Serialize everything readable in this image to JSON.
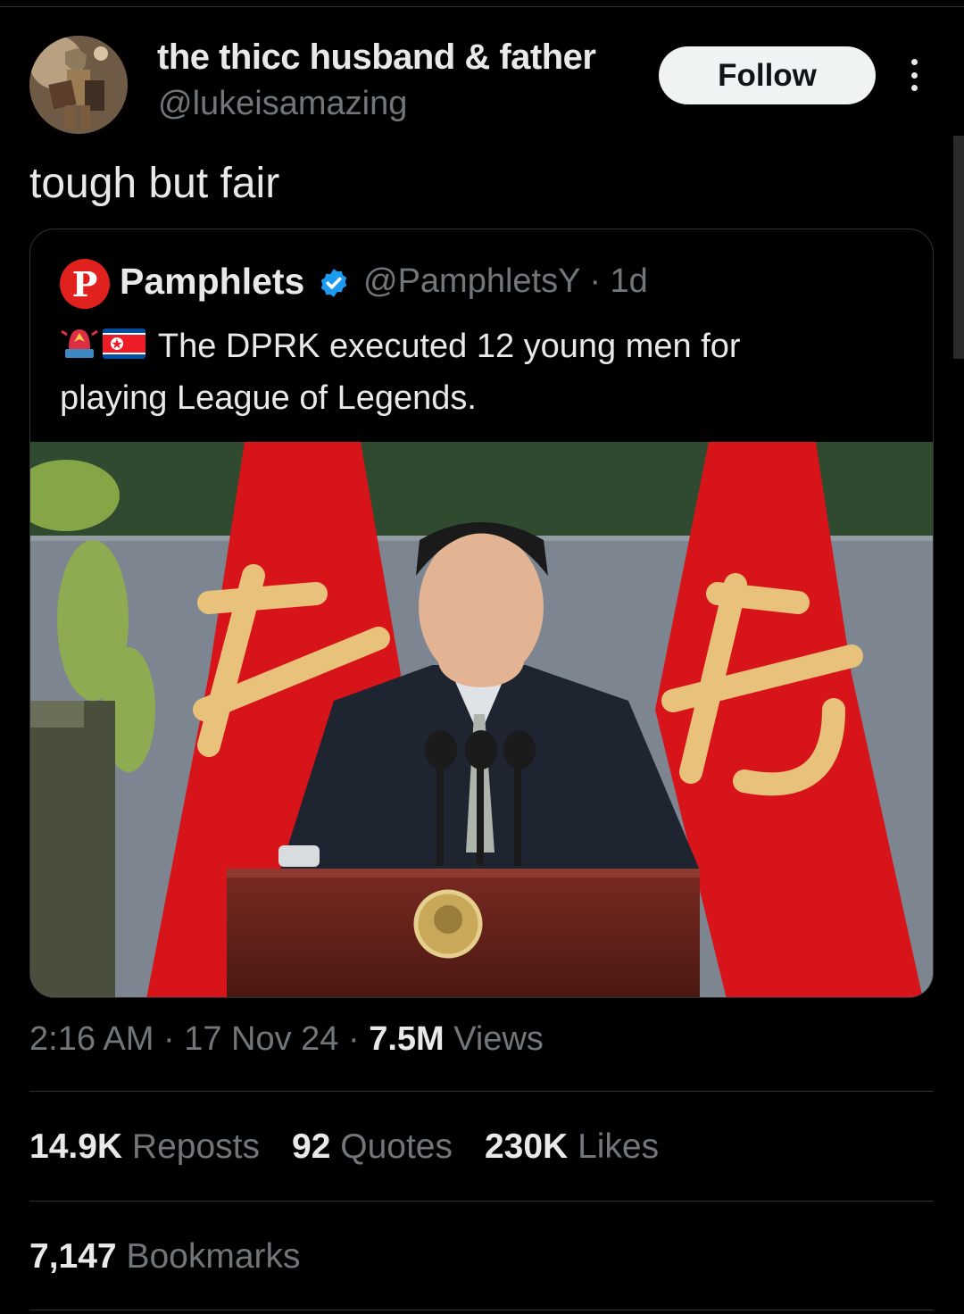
{
  "author": {
    "display_name": "the thicc husband & father",
    "handle": "@lukeisamazing"
  },
  "follow_label": "Follow",
  "tweet_text": "tough but fair",
  "quoted": {
    "logo_letter": "P",
    "name": "Pamphlets",
    "handle_time": "@PamphletsY · 1d",
    "emoji_icons": [
      "rotating-light-icon",
      "north-korea-flag-icon"
    ],
    "text_line1": "The DPRK executed 12 young men for",
    "text_line2": "playing League of Legends."
  },
  "meta": {
    "time_date": "2:16 AM · 17 Nov 24 · ",
    "views_count": "7.5M",
    "views_label": " Views"
  },
  "stats": {
    "reposts_count": "14.9K",
    "reposts_label": "Reposts",
    "quotes_count": "92",
    "quotes_label": "Quotes",
    "likes_count": "230K",
    "likes_label": "Likes",
    "bookmarks_count": "7,147",
    "bookmarks_label": "Bookmarks"
  },
  "colors": {
    "background": "#000000",
    "text_primary": "#e7e9ea",
    "text_secondary": "#71767b",
    "border": "#2f3336",
    "verified": "#1d9bf0",
    "follow_bg": "#eff3f4",
    "pamphlets_red": "#e0211d"
  }
}
